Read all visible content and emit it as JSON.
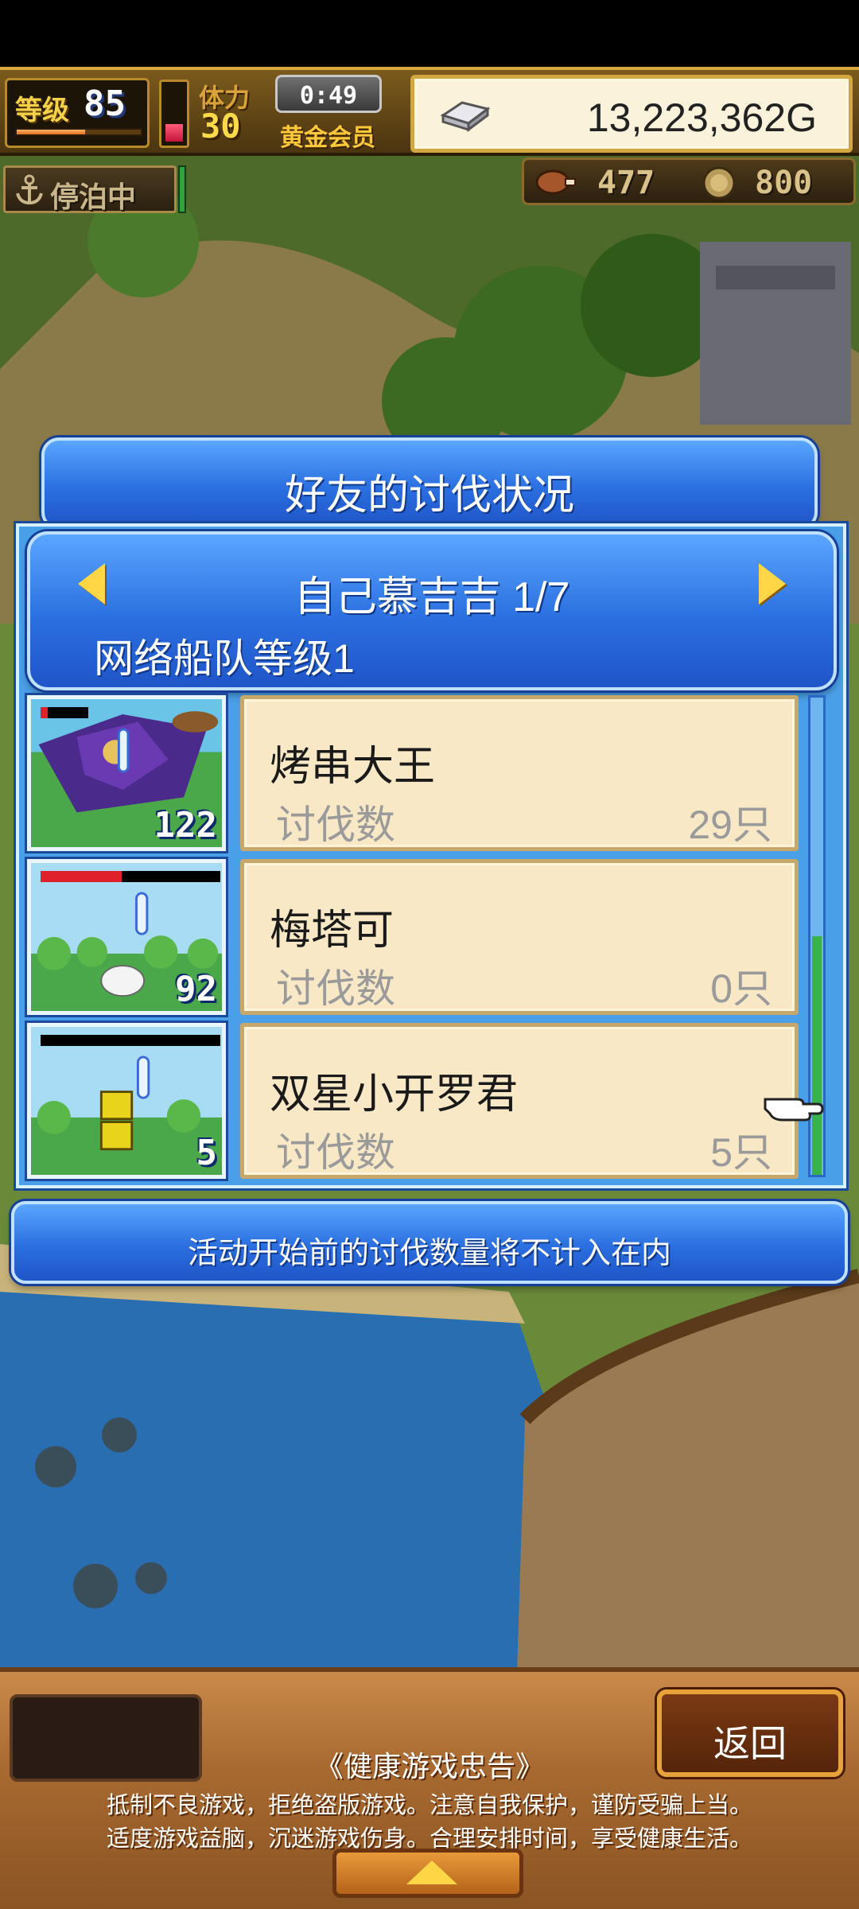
{
  "hud": {
    "level_label": "等级",
    "level_value": "85",
    "level_progress": 0.55,
    "stamina_label": "体力",
    "stamina_value": "30",
    "stamina_gauge": 0.4,
    "timer": "0:49",
    "membership": "黄金会员",
    "money": "13,223,362G"
  },
  "status": {
    "docked_label": "停泊中",
    "meat_count": "477",
    "coin_count": "800"
  },
  "dialog": {
    "title": "好友的讨伐状况",
    "friend_name": "自己慕吉吉 1/7",
    "fleet_level": "网络船队等级1",
    "notice": "活动开始前的讨伐数量将不计入在内"
  },
  "targets": [
    {
      "name": "烤串大王",
      "kill_label": "讨伐数",
      "kill_count": "29只",
      "thumb_number": "122",
      "hp": 0.15
    },
    {
      "name": "梅塔可",
      "kill_label": "讨伐数",
      "kill_count": "0只",
      "thumb_number": "92",
      "hp": 0.45
    },
    {
      "name": "双星小开罗君",
      "kill_label": "讨伐数",
      "kill_count": "5只",
      "thumb_number": "5",
      "hp": 0.0
    }
  ],
  "bottom": {
    "back_label": "返回",
    "advisory_title": "《健康游戏忠告》",
    "advisory_line1": "抵制不良游戏，拒绝盗版游戏。注意自我保护，谨防受骗上当。",
    "advisory_line2": "适度游戏益脑，沉迷游戏伤身。合理安排时间，享受健康生活。"
  },
  "colors": {
    "panel_blue": "#2b6fe0",
    "card_bg": "#f8e8c6",
    "gold": "#e8c25a"
  }
}
